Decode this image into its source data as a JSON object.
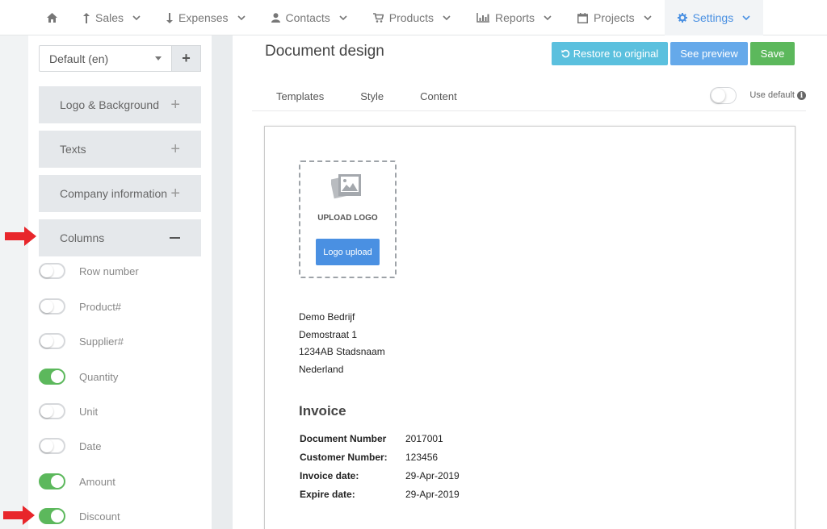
{
  "nav": {
    "items": [
      {
        "key": "home",
        "label": "",
        "icon": "home-icon"
      },
      {
        "key": "sales",
        "label": "Sales",
        "icon": "arrow-up-icon"
      },
      {
        "key": "expenses",
        "label": "Expenses",
        "icon": "arrow-down-icon"
      },
      {
        "key": "contacts",
        "label": "Contacts",
        "icon": "user-icon"
      },
      {
        "key": "products",
        "label": "Products",
        "icon": "cart-icon"
      },
      {
        "key": "reports",
        "label": "Reports",
        "icon": "bar-chart-icon"
      },
      {
        "key": "projects",
        "label": "Projects",
        "icon": "calendar-icon"
      },
      {
        "key": "settings",
        "label": "Settings",
        "icon": "gear-icon"
      }
    ],
    "active": "settings",
    "accent": "#4a90e2"
  },
  "sidebar": {
    "language_value": "Default (en)",
    "add_symbol": "+",
    "sections": [
      {
        "label": "Logo & Background",
        "state": "collapsed"
      },
      {
        "label": "Texts",
        "state": "collapsed"
      },
      {
        "label": "Company information",
        "state": "collapsed"
      },
      {
        "label": "Columns",
        "state": "expanded"
      }
    ],
    "columns": [
      {
        "label": "Row number",
        "on": false
      },
      {
        "label": "Product#",
        "on": false
      },
      {
        "label": "Supplier#",
        "on": false
      },
      {
        "label": "Quantity",
        "on": true
      },
      {
        "label": "Unit",
        "on": false
      },
      {
        "label": "Date",
        "on": false
      },
      {
        "label": "Amount",
        "on": true
      },
      {
        "label": "Discount",
        "on": true
      }
    ]
  },
  "main": {
    "title": "Document design",
    "buttons": {
      "restore": "Restore to original",
      "preview": "See preview",
      "save": "Save"
    },
    "tabs": [
      "Templates",
      "Style",
      "Content"
    ],
    "use_default_label": "Use default",
    "use_default_on": false,
    "document": {
      "upload_label": "UPLOAD LOGO",
      "upload_button": "Logo upload",
      "company_lines": [
        "Demo Bedrijf",
        "Demostraat 1",
        "1234AB Stadsnaam",
        "Nederland"
      ],
      "invoice_title": "Invoice",
      "fields": [
        {
          "key": "Document Number",
          "value": "2017001"
        },
        {
          "key": "Customer Number:",
          "value": "123456"
        },
        {
          "key": "Invoice date:",
          "value": "29-Apr-2019"
        },
        {
          "key": "Expire date:",
          "value": "29-Apr-2019"
        }
      ]
    }
  },
  "colors": {
    "restore": "#5bc0de",
    "preview": "#65a9ea",
    "save": "#5cb85c",
    "toggle_on": "#5cb85c",
    "arrow": "#e8262b"
  }
}
